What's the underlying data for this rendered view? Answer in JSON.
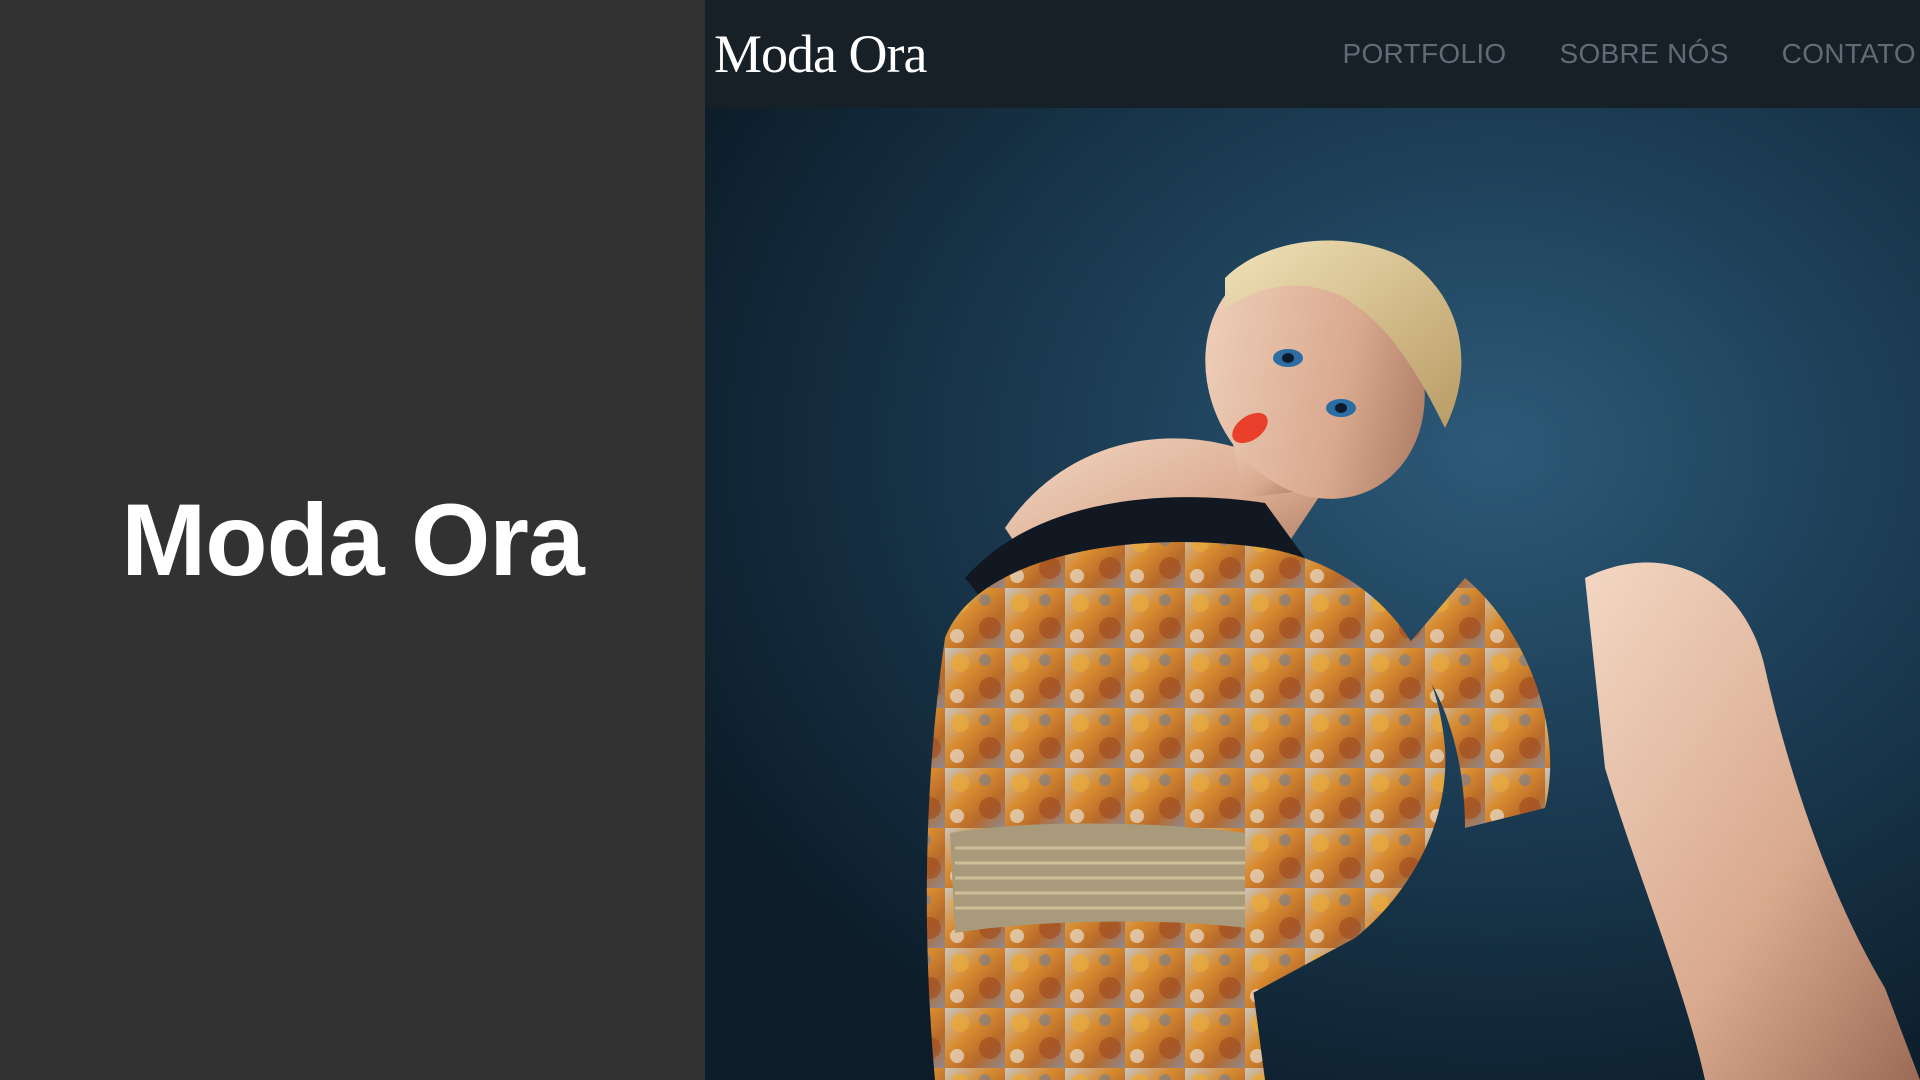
{
  "title_panel": {
    "title": "Moda Ora"
  },
  "site": {
    "brand": "Moda Ora",
    "nav": [
      {
        "label": "PORTFOLIO"
      },
      {
        "label": "SOBRE NÓS"
      },
      {
        "label": "CONTATO"
      }
    ]
  },
  "hero": {
    "image_subject": "fashion-model-photo"
  },
  "colors": {
    "panel_bg": "#323232",
    "nav_bg": "#171f27",
    "nav_link": "#5f6c78",
    "hero_bg": "#1b3a50"
  }
}
